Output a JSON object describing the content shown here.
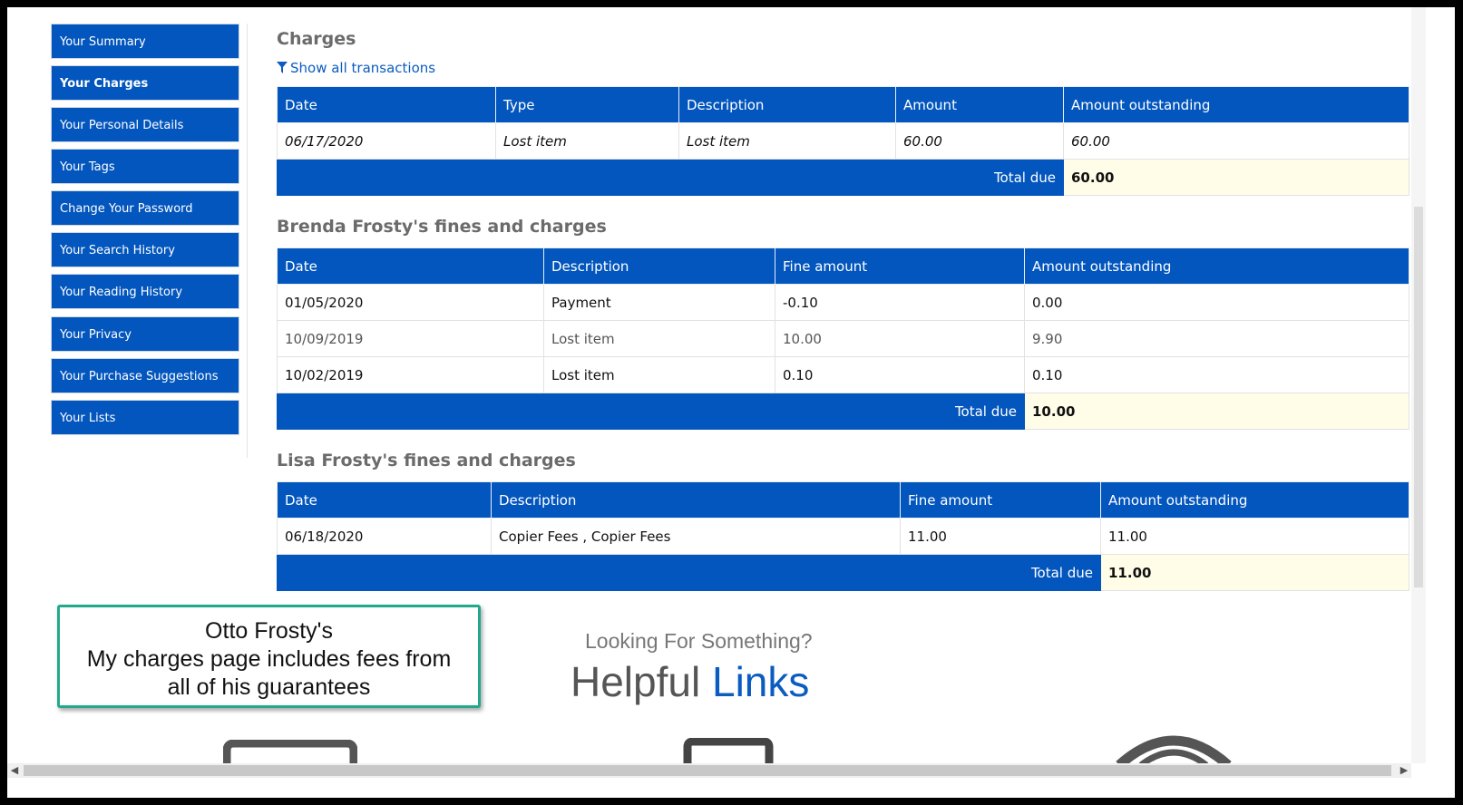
{
  "sidebar": {
    "items": [
      {
        "label": "Your Summary"
      },
      {
        "label": "Your Charges"
      },
      {
        "label": "Your Personal Details"
      },
      {
        "label": "Your Tags"
      },
      {
        "label": "Change Your Password"
      },
      {
        "label": "Your Search History"
      },
      {
        "label": "Your Reading History"
      },
      {
        "label": "Your Privacy"
      },
      {
        "label": "Your Purchase Suggestions"
      },
      {
        "label": "Your Lists"
      }
    ],
    "active": "Your Charges"
  },
  "charges": {
    "heading": "Charges",
    "filter_label": "Show all transactions",
    "filter_icon": "filter-icon",
    "columns": [
      "Date",
      "Type",
      "Description",
      "Amount",
      "Amount outstanding"
    ],
    "rows": [
      {
        "date": "06/17/2020",
        "type": "Lost item",
        "description": "Lost item",
        "amount": "60.00",
        "outstanding": "60.00"
      }
    ],
    "total_label": "Total due",
    "total_value": "60.00"
  },
  "brenda": {
    "heading": "Brenda Frosty's fines and charges",
    "columns": [
      "Date",
      "Description",
      "Fine amount",
      "Amount outstanding"
    ],
    "rows": [
      {
        "date": "01/05/2020",
        "description": "Payment",
        "amount": "-0.10",
        "outstanding": "0.00"
      },
      {
        "date": "10/09/2019",
        "description": "Lost item",
        "amount": "10.00",
        "outstanding": "9.90"
      },
      {
        "date": "10/02/2019",
        "description": "Lost item",
        "amount": "0.10",
        "outstanding": "0.10"
      }
    ],
    "total_label": "Total due",
    "total_value": "10.00"
  },
  "lisa": {
    "heading": "Lisa Frosty's fines and charges",
    "columns": [
      "Date",
      "Description",
      "Fine amount",
      "Amount outstanding"
    ],
    "rows": [
      {
        "date": "06/18/2020",
        "description": "Copier Fees , Copier Fees",
        "amount": "11.00",
        "outstanding": "11.00"
      }
    ],
    "total_label": "Total due",
    "total_value": "11.00"
  },
  "callout": {
    "line1": "Otto Frosty's",
    "line2": "My charges page includes fees from",
    "line3": "all of his guarantees",
    "border_color": "#22a98c"
  },
  "helpful_links": {
    "subtitle": "Looking For Something?",
    "title_part1": "Helpful",
    "title_part2": "Links"
  },
  "colors": {
    "brand_blue": "#0356bd",
    "link_blue": "#0b5cc0",
    "total_bg": "#fffde8"
  }
}
